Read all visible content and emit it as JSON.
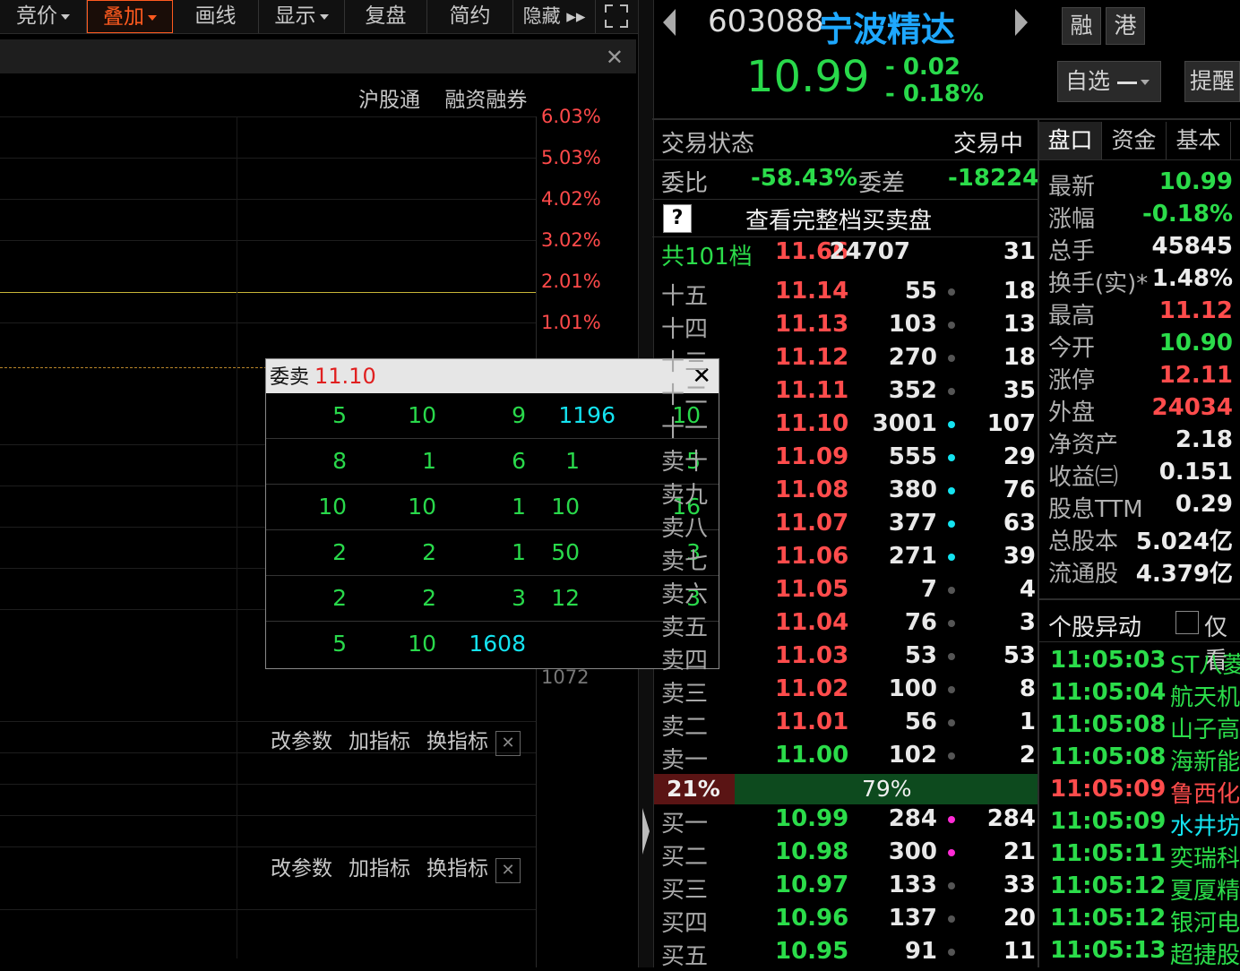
{
  "toolbar": {
    "items": [
      {
        "label": "竞价",
        "caret": true
      },
      {
        "label": "叠加",
        "caret": true,
        "active": true
      },
      {
        "label": "画线",
        "caret": false
      },
      {
        "label": "显示",
        "caret": true
      },
      {
        "label": "复盘",
        "caret": false
      },
      {
        "label": "简约",
        "caret": false
      },
      {
        "label": "隐藏 ▸▸",
        "caret": false
      }
    ],
    "fullscreen_icon": "expand-icon"
  },
  "chart": {
    "tabs": [
      "沪股通",
      "融资融券"
    ],
    "pct_labels": [
      "6.03%",
      "5.03%",
      "4.02%",
      "3.02%",
      "2.01%",
      "1.01%"
    ],
    "volume_label": "1072",
    "indicator_buttons": [
      "改参数",
      "加指标",
      "换指标"
    ]
  },
  "popup": {
    "title": "委卖",
    "price": "11.10",
    "rows": [
      [
        "5",
        "10",
        "9",
        "1196",
        "10"
      ],
      [
        "8",
        "1",
        "6",
        "1",
        "5"
      ],
      [
        "10",
        "10",
        "1",
        "10",
        "16"
      ],
      [
        "2",
        "2",
        "1",
        "50",
        "3"
      ],
      [
        "2",
        "2",
        "3",
        "12",
        "3"
      ],
      [
        "5",
        "10",
        "1608"
      ]
    ]
  },
  "quote": {
    "code": "603088",
    "name": "宁波精达",
    "price": "10.99",
    "change": "- 0.02",
    "change_pct": "- 0.18%",
    "btn_rong": "融",
    "btn_gang": "港",
    "btn_zixuan": "自选",
    "btn_tixing": "提醒"
  },
  "orderbook": {
    "status_label": "交易状态",
    "status_value": "交易中",
    "weibi_label": "委比",
    "weibi_value": "-58.43%",
    "weicha_label": "委差",
    "weicha_value": "-18224",
    "help": "?",
    "full_link": "查看完整档买卖盘",
    "total": {
      "label": "共101档",
      "price": "11.66",
      "vol": "24707",
      "cnt": "31"
    },
    "sells": [
      {
        "n": "十五",
        "p": "11.14",
        "v": "55",
        "c": "18",
        "dot": "gray"
      },
      {
        "n": "十四",
        "p": "11.13",
        "v": "103",
        "c": "13",
        "dot": "gray"
      },
      {
        "n": "十三",
        "p": "11.12",
        "v": "270",
        "c": "18",
        "dot": "gray"
      },
      {
        "n": "十二",
        "p": "11.11",
        "v": "352",
        "c": "35",
        "dot": "gray"
      },
      {
        "n": "十一",
        "p": "11.10",
        "v": "3001",
        "c": "107",
        "dot": "cyan"
      },
      {
        "n": "卖十",
        "p": "11.09",
        "v": "555",
        "c": "29",
        "dot": "cyan"
      },
      {
        "n": "卖九",
        "p": "11.08",
        "v": "380",
        "c": "76",
        "dot": "cyan"
      },
      {
        "n": "卖八",
        "p": "11.07",
        "v": "377",
        "c": "63",
        "dot": "cyan"
      },
      {
        "n": "卖七",
        "p": "11.06",
        "v": "271",
        "c": "39",
        "dot": "cyan"
      },
      {
        "n": "卖六",
        "p": "11.05",
        "v": "7",
        "c": "4",
        "dot": "gray"
      },
      {
        "n": "卖五",
        "p": "11.04",
        "v": "76",
        "c": "3",
        "dot": "gray"
      },
      {
        "n": "卖四",
        "p": "11.03",
        "v": "53",
        "c": "53",
        "dot": "gray"
      },
      {
        "n": "卖三",
        "p": "11.02",
        "v": "100",
        "c": "8",
        "dot": "gray"
      },
      {
        "n": "卖二",
        "p": "11.01",
        "v": "56",
        "c": "1",
        "dot": "gray"
      },
      {
        "n": "卖一",
        "p": "11.00",
        "v": "102",
        "c": "2",
        "dot": "gray"
      }
    ],
    "ratio_buy": "21%",
    "ratio_buy_fraction": 0.21,
    "ratio_sell": "79%",
    "buys": [
      {
        "n": "买一",
        "p": "10.99",
        "v": "284",
        "c": "284",
        "dot": "magenta"
      },
      {
        "n": "买二",
        "p": "10.98",
        "v": "300",
        "c": "21",
        "dot": "magenta"
      },
      {
        "n": "买三",
        "p": "10.97",
        "v": "133",
        "c": "33",
        "dot": "gray"
      },
      {
        "n": "买四",
        "p": "10.96",
        "v": "137",
        "c": "20",
        "dot": "gray"
      },
      {
        "n": "买五",
        "p": "10.95",
        "v": "91",
        "c": "11",
        "dot": "gray"
      }
    ]
  },
  "stats": {
    "tabs": [
      "盘口",
      "资金",
      "基本"
    ],
    "rows": [
      {
        "k": "最新",
        "v": "10.99",
        "color": "green"
      },
      {
        "k": "涨幅",
        "v": "-0.18%",
        "color": "green"
      },
      {
        "k": "总手",
        "v": "45845",
        "color": "white"
      },
      {
        "k": "换手(实)*",
        "v": "1.48%",
        "color": "white"
      },
      {
        "k": "最高",
        "v": "11.12",
        "color": "red"
      },
      {
        "k": "今开",
        "v": "10.90",
        "color": "green"
      },
      {
        "k": "涨停",
        "v": "12.11",
        "color": "red"
      },
      {
        "k": "外盘",
        "v": "24034",
        "color": "red"
      },
      {
        "k": "净资产",
        "v": "2.18",
        "color": "white"
      },
      {
        "k": "收益㈢",
        "v": "0.151",
        "color": "white"
      },
      {
        "k": "股息TTM",
        "v": "0.29",
        "color": "white"
      },
      {
        "k": "总股本",
        "v": "5.024亿",
        "color": "white"
      },
      {
        "k": "流通股",
        "v": "4.379亿",
        "color": "white"
      }
    ]
  },
  "events": {
    "title": "个股异动",
    "checkbox_label": "仅看",
    "rows": [
      {
        "t": "11:05:03",
        "n": "ST八菱",
        "color": "green"
      },
      {
        "t": "11:05:04",
        "n": "航天机电",
        "color": "green"
      },
      {
        "t": "11:05:08",
        "n": "山子高科",
        "color": "green"
      },
      {
        "t": "11:05:08",
        "n": "海新能科",
        "color": "green"
      },
      {
        "t": "11:05:09",
        "n": "鲁西化工",
        "color": "red"
      },
      {
        "t": "11:05:09",
        "n": "水井坊",
        "color": "green"
      },
      {
        "t": "11:05:11",
        "n": "奕瑞科技",
        "color": "green"
      },
      {
        "t": "11:05:12",
        "n": "夏厦精密",
        "color": "green"
      },
      {
        "t": "11:05:12",
        "n": "银河电子",
        "color": "green"
      },
      {
        "t": "11:05:13",
        "n": "超捷股份",
        "color": "green"
      }
    ]
  }
}
